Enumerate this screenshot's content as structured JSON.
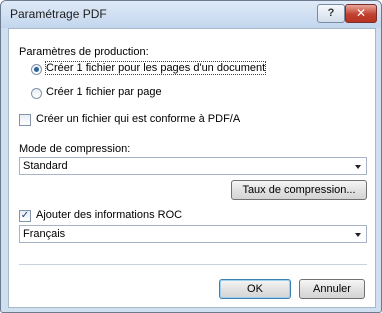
{
  "window": {
    "title": "Paramétrage PDF",
    "help_glyph": "?",
    "close_glyph": "✕"
  },
  "production": {
    "label": "Paramètres de production:",
    "options": [
      {
        "label": "Créer 1 fichier pour les pages d'un document",
        "selected": true
      },
      {
        "label": "Créer 1 fichier par page",
        "selected": false
      }
    ]
  },
  "pdfa": {
    "label": "Créer un fichier qui est conforme à PDF/A",
    "checked": false
  },
  "compression": {
    "label": "Mode de compression:",
    "value": "Standard",
    "rate_button": "Taux de compression..."
  },
  "ocr": {
    "label": "Ajouter des informations ROC",
    "checked": true,
    "language": "Français"
  },
  "footer": {
    "ok": "OK",
    "cancel": "Annuler"
  },
  "colors": {
    "accent": "#2d5f9c",
    "close": "#c1402f",
    "frame": "#cfdff0"
  }
}
